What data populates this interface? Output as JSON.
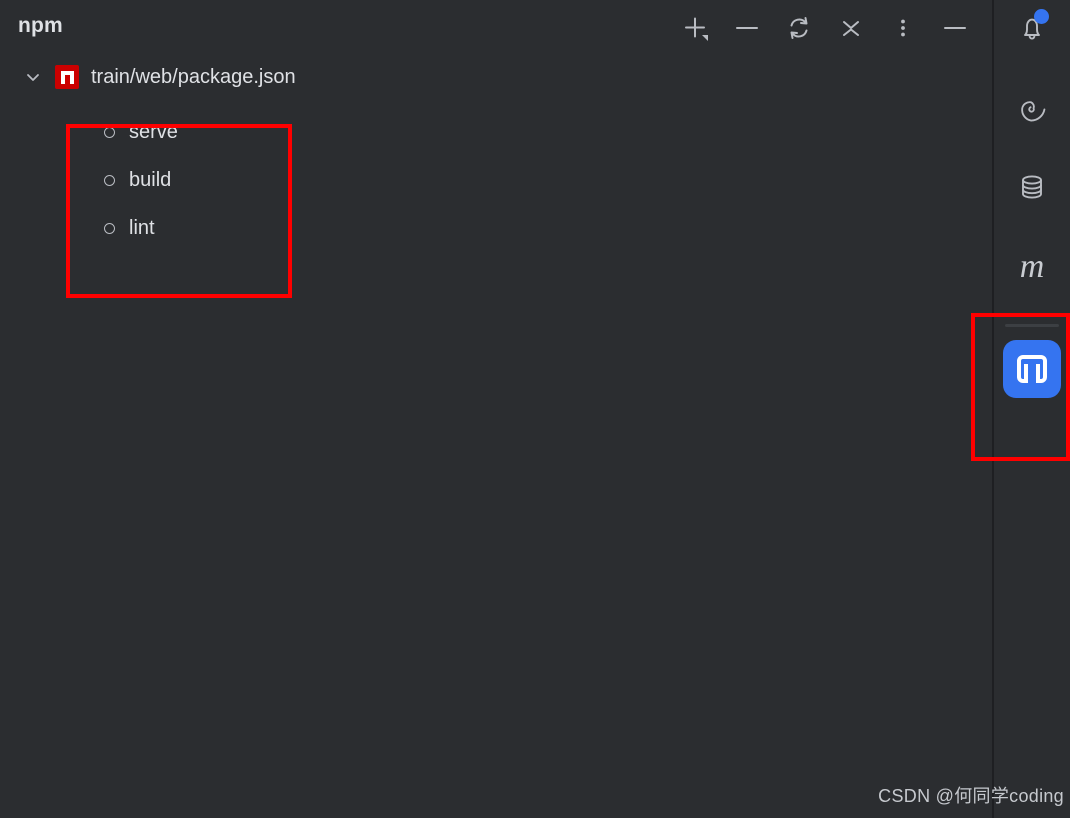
{
  "window": {
    "background_color": "#2b2d30",
    "panel_title": "npm"
  },
  "toolbar": {
    "items": [
      {
        "name": "add-script-button",
        "icon": "plus-with-dropdown-icon",
        "tooltip": "Add"
      },
      {
        "name": "remove-button",
        "icon": "minus-icon",
        "tooltip": "Remove"
      },
      {
        "name": "reload-button",
        "icon": "sync-refresh-icon",
        "tooltip": "Reload All npm Projects"
      },
      {
        "name": "collapse-all-button",
        "icon": "collapse-all-icon",
        "tooltip": "Collapse All"
      },
      {
        "name": "options-button",
        "icon": "more-vertical-dots-icon",
        "tooltip": "Options"
      },
      {
        "name": "hide-button",
        "icon": "minimize-icon",
        "tooltip": "Hide"
      }
    ]
  },
  "tree": {
    "root": {
      "label": "train/web/package.json",
      "icon": "npm-package-icon",
      "expanded": true,
      "chevron": "chevron-down-icon"
    },
    "scripts": [
      {
        "label": "serve",
        "icon": "run-script-circle-icon"
      },
      {
        "label": "build",
        "icon": "run-script-circle-icon"
      },
      {
        "label": "lint",
        "icon": "run-script-circle-icon"
      }
    ]
  },
  "annotations": {
    "accent_color": "#ff0000",
    "boxes": [
      {
        "name": "scripts-highlight",
        "target": "npm scripts list"
      },
      {
        "name": "npm-tool-button-highlight",
        "target": "npm tool window button"
      }
    ]
  },
  "sidebar": {
    "items": [
      {
        "name": "notifications",
        "icon": "bell-icon",
        "badge": true,
        "badge_color": "#3574f0"
      },
      {
        "name": "spiral-tool",
        "icon": "spiral-icon"
      },
      {
        "name": "database",
        "icon": "database-icon"
      },
      {
        "name": "maven",
        "icon": "maven-m-icon",
        "label": "m"
      },
      {
        "name": "npm",
        "icon": "npm-tool-icon",
        "selected": true,
        "accent_color": "#3574f0"
      }
    ]
  },
  "watermark": {
    "text": "CSDN @何同学coding"
  }
}
